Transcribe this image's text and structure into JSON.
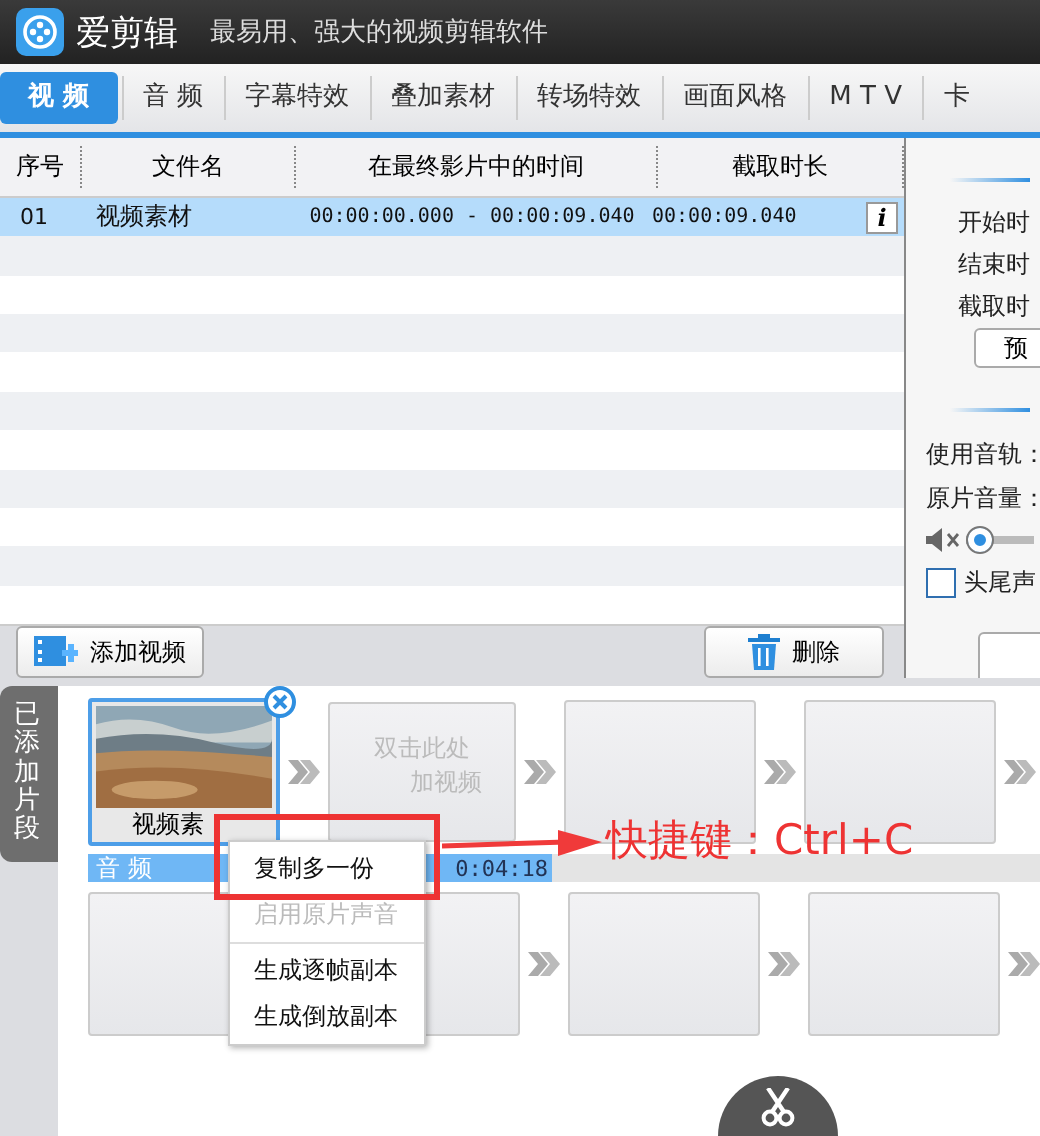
{
  "app": {
    "title": "爱剪辑",
    "slogan": "最易用、强大的视频剪辑软件"
  },
  "tabs": [
    {
      "label": "视 频",
      "selected": true
    },
    {
      "label": "音 频",
      "selected": false
    },
    {
      "label": "字幕特效",
      "selected": false
    },
    {
      "label": "叠加素材",
      "selected": false
    },
    {
      "label": "转场特效",
      "selected": false
    },
    {
      "label": "画面风格",
      "selected": false
    },
    {
      "label": "M T V",
      "selected": false
    },
    {
      "label": "卡",
      "selected": false
    }
  ],
  "table": {
    "columns": [
      "序号",
      "文件名",
      "在最终影片中的时间",
      "截取时长"
    ],
    "rows": [
      {
        "cells": [
          "01",
          "视频素材",
          "00:00:00.000 - 00:00:09.040",
          "00:00:09.040"
        ],
        "info": "i",
        "selected": true
      }
    ]
  },
  "buttons": {
    "add": "添加视频",
    "delete": "删除"
  },
  "right_panel": {
    "fields": [
      "开始时",
      "结束时",
      "截取时"
    ],
    "preview": "预",
    "track": "使用音轨：",
    "volume": "原片音量：",
    "tail_checkbox": {
      "label": "头尾声",
      "checked": false
    }
  },
  "timeline": {
    "side_tab": "已添加片段",
    "clips": [
      {
        "kind": "clip",
        "label": "视频素",
        "selected": true
      },
      {
        "kind": "placeholder",
        "lines": [
          "双击此处",
          "加视频"
        ]
      },
      {
        "kind": "empty"
      },
      {
        "kind": "empty"
      }
    ],
    "audio_label": "音 频",
    "audio_time": "0:04:18",
    "audio_slots": [
      {
        "kind": "empty"
      },
      {
        "kind": "empty"
      },
      {
        "kind": "empty"
      },
      {
        "kind": "empty"
      }
    ]
  },
  "context_menu": [
    {
      "kind": "item",
      "label": "复制多一份",
      "disabled": false
    },
    {
      "kind": "item",
      "label": "启用原片声音",
      "disabled": true
    },
    {
      "kind": "separator"
    },
    {
      "kind": "item",
      "label": "生成逐帧副本",
      "disabled": false
    },
    {
      "kind": "item",
      "label": "生成倒放副本",
      "disabled": false
    }
  ],
  "annotation": {
    "text": "快捷键：Ctrl+C"
  }
}
